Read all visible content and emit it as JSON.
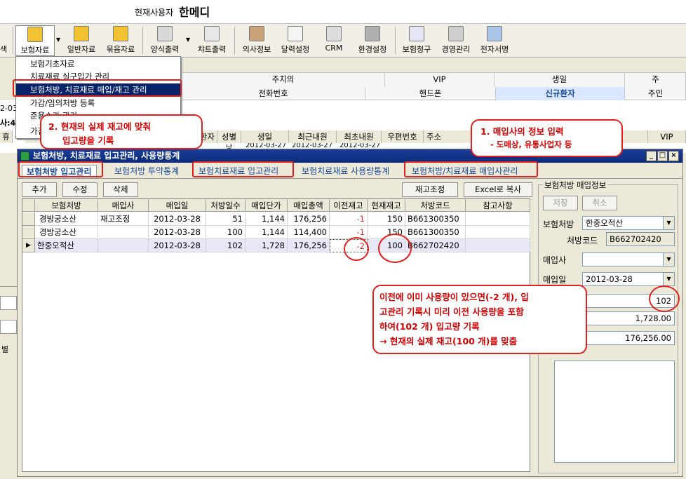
{
  "header": {
    "current_user_label": "현재사용자",
    "current_user": "한메디"
  },
  "toolbar": {
    "left_fragment": "색",
    "items": [
      {
        "label": "보험자료",
        "icon": "folder-icon"
      },
      {
        "label": "일반자료",
        "icon": "folder-icon"
      },
      {
        "label": "묶음자료",
        "icon": "folder-icon"
      },
      {
        "label": "양식출력",
        "icon": "printer-icon"
      },
      {
        "label": "챠트출력",
        "icon": "chart-print-icon"
      },
      {
        "label": "의사정보",
        "icon": "doctor-icon"
      },
      {
        "label": "달력설정",
        "icon": "calendar-icon"
      },
      {
        "label": "CRM",
        "icon": "crm-icon"
      },
      {
        "label": "환경설정",
        "icon": "settings-icon"
      },
      {
        "label": "보험청구",
        "icon": "claim-icon"
      },
      {
        "label": "경영관리",
        "icon": "management-icon"
      },
      {
        "label": "전자서명",
        "icon": "signature-pen-icon"
      }
    ]
  },
  "menu": {
    "items": [
      "보험기초자료",
      "치료재료 실구입가 관리",
      "보험처방, 치료재료 매입/재고 관리",
      "가감/임의처방 등록",
      "준용수가 관리",
      "가검"
    ]
  },
  "background": {
    "row1": [
      "주치의",
      "VIP",
      "생일",
      "주"
    ],
    "row2": [
      "전화번호",
      "핸드폰",
      "신규환자",
      "주민"
    ],
    "date_fragment": "2-03",
    "label_fragment": "사:4",
    "col_fragment_1": "휴",
    "col_fragment_2": "가",
    "columns": [
      "환자",
      "성별",
      "생일",
      "최근내원",
      "최초내원",
      "우편번호",
      "주소",
      "VIP"
    ],
    "row_fragment": [
      "남",
      "2012-03-27",
      "2012-03-27",
      "2012-03-27"
    ],
    "left_label": "별"
  },
  "window": {
    "title": "보험처방, 치료재료 입고관리, 사용량통계",
    "tabs": [
      "보험처방 입고관리",
      "보험처방 투약통계",
      "보험치료재료 입고관리",
      "보험치료재료 사용량통계",
      "보험처방/치료재료 매입사관리"
    ],
    "buttons": {
      "add": "추가",
      "edit": "수정",
      "delete": "삭제",
      "stock_adjust": "재고조정",
      "excel": "Excel로 복사"
    },
    "grid": {
      "headers": [
        "보험처방",
        "매입사",
        "매입일",
        "처방일수",
        "매입단가",
        "매입총액",
        "이전재고",
        "현재재고",
        "처방코드",
        "참고사항"
      ],
      "rows": [
        [
          "경방궁소산",
          "재고조정",
          "2012-03-28",
          "51",
          "1,144",
          "176,256",
          "-1",
          "150",
          "B661300350",
          ""
        ],
        [
          "경방궁소산",
          "",
          "2012-03-28",
          "100",
          "1,144",
          "114,400",
          "-1",
          "150",
          "B661300350",
          ""
        ],
        [
          "한중오적산",
          "",
          "2012-03-28",
          "102",
          "1,728",
          "176,256",
          "-2",
          "100",
          "B662702420",
          ""
        ]
      ],
      "selected_marker": "▶"
    },
    "panel": {
      "title": "보험처방 매입정보",
      "save": "저장",
      "cancel": "취소",
      "prescription_label": "보험처방",
      "prescription_value": "한중오적산",
      "code_label": "처방코드",
      "code_value": "B662702420",
      "vendor_label": "매입사",
      "vendor_value": "",
      "date_label": "매입일",
      "date_value": "2012-03-28",
      "days_value": "102",
      "unit_price_value": "1,728.00",
      "total_value": "176,256.00"
    }
  },
  "annotations": {
    "callout_1": [
      "1. 매입사의 정보 입력",
      "- 도매상, 유통사업자 등"
    ],
    "callout_2": [
      "2. 현재의 실제 재고에 맞춰",
      "입고량을 기록"
    ],
    "callout_3": [
      "이전에 이미 사용량이 있으면(-2 개), 입",
      "고관리 기록시 미리 이전 사용량을 포함",
      "하여(102 개) 입고량 기록",
      "→ 현재의 실제 재고(100 개)를 맞춤"
    ]
  }
}
